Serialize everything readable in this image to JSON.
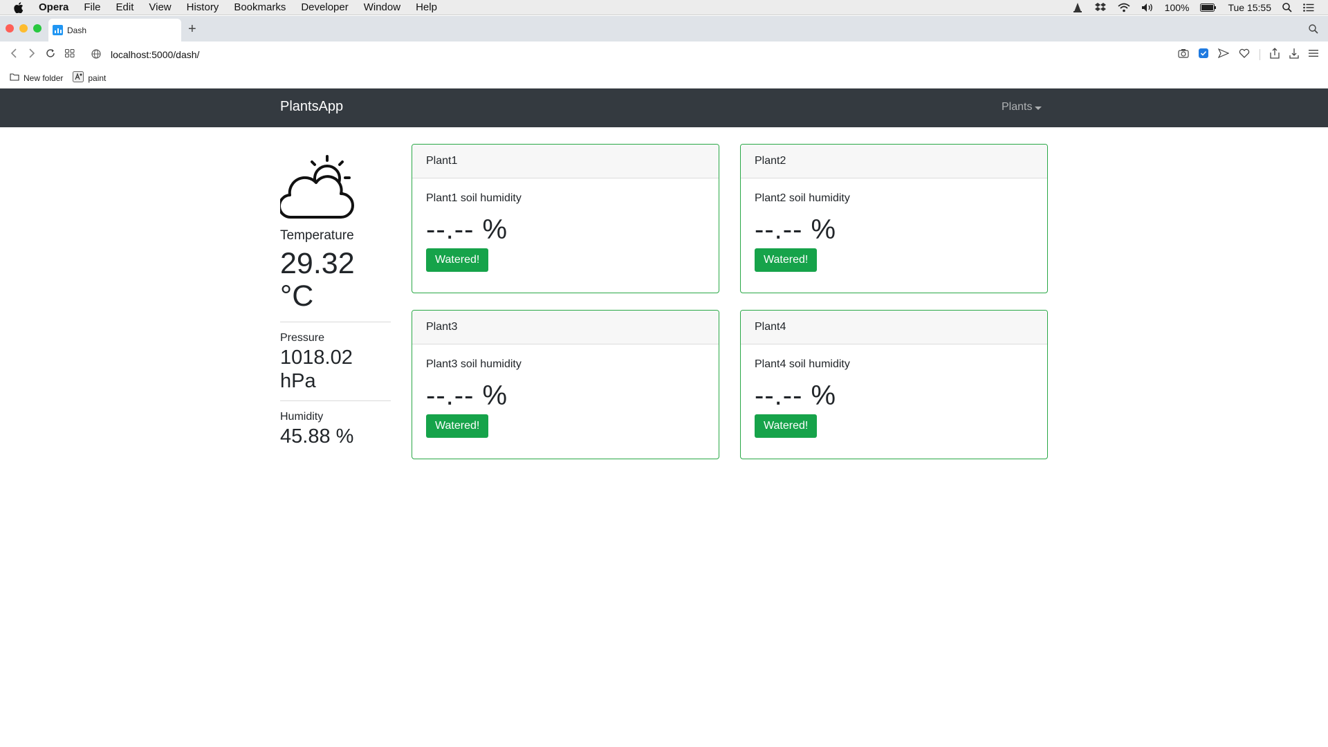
{
  "menubar": {
    "app": "Opera",
    "items": [
      "File",
      "Edit",
      "View",
      "History",
      "Bookmarks",
      "Developer",
      "Window",
      "Help"
    ],
    "battery": "100%",
    "clock": "Tue 15:55"
  },
  "browser": {
    "tab_title": "Dash",
    "url": "localhost:5000/dash/",
    "bookmarks": [
      "New folder",
      "paint"
    ]
  },
  "app": {
    "brand": "PlantsApp",
    "menu": "Plants"
  },
  "weather": {
    "temperature_label": "Temperature",
    "temperature_value": "29.32 °C",
    "pressure_label": "Pressure",
    "pressure_value": "1018.02 hPa",
    "humidity_label": "Humidity",
    "humidity_value": "45.88 %"
  },
  "plants": [
    {
      "name": "Plant1",
      "title": "Plant1 soil humidity",
      "value": "--.-- %",
      "button": "Watered!"
    },
    {
      "name": "Plant2",
      "title": "Plant2 soil humidity",
      "value": "--.-- %",
      "button": "Watered!"
    },
    {
      "name": "Plant3",
      "title": "Plant3 soil humidity",
      "value": "--.-- %",
      "button": "Watered!"
    },
    {
      "name": "Plant4",
      "title": "Plant4 soil humidity",
      "value": "--.-- %",
      "button": "Watered!"
    }
  ],
  "colors": {
    "navbar": "#343a40",
    "card_border": "#28a745",
    "button": "#16a34a"
  }
}
